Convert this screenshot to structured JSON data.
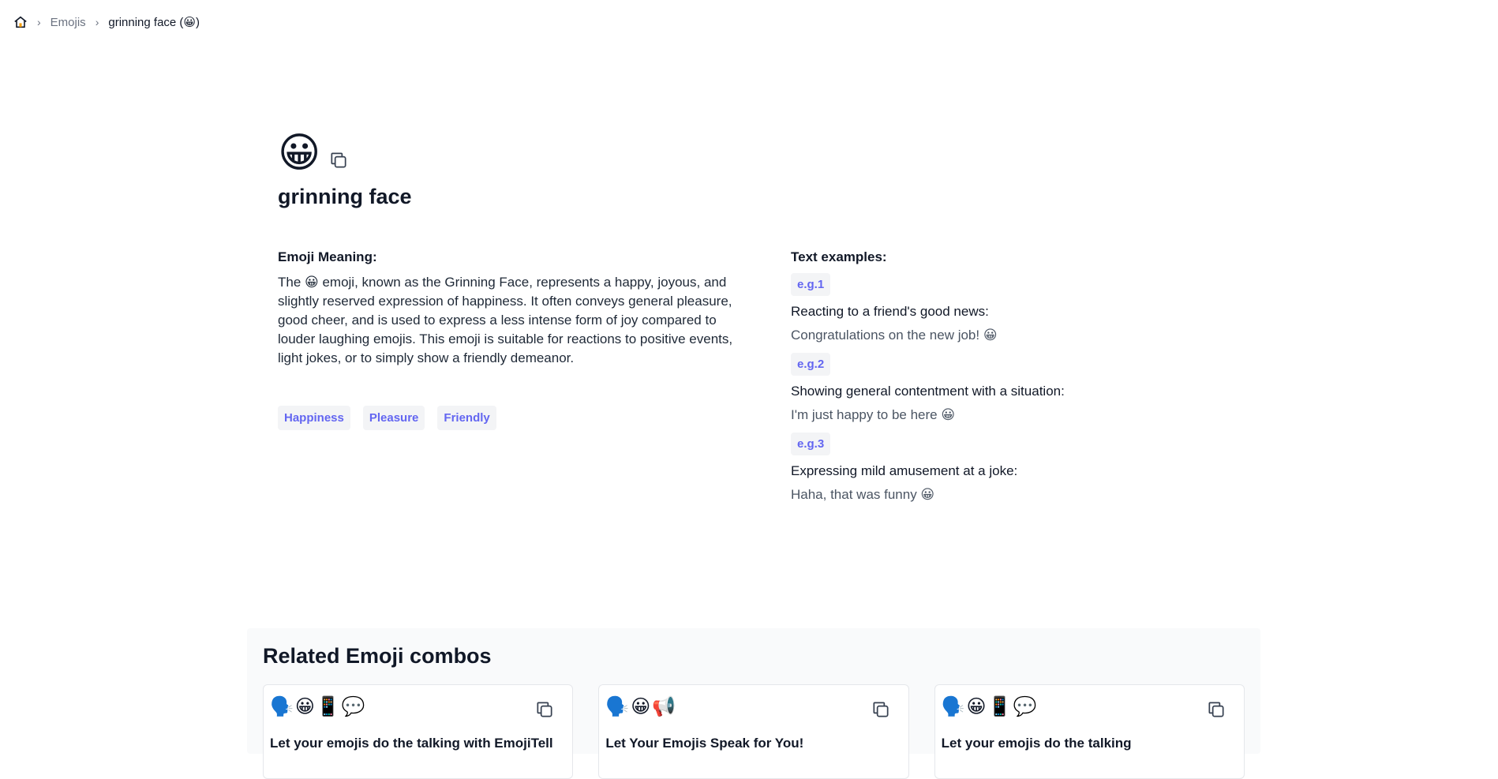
{
  "breadcrumb": {
    "home_icon": "home-icon",
    "items": [
      "Emojis",
      "grinning face (😀)"
    ]
  },
  "emoji": {
    "glyph": "😀",
    "name": "grinning face"
  },
  "meaning": {
    "label": "Emoji Meaning:",
    "text": "The 😀 emoji, known as the Grinning Face, represents a happy, joyous, and slightly reserved expression of happiness. It often conveys general pleasure, good cheer, and is used to express a less intense form of joy compared to louder laughing emojis. This emoji is suitable for reactions to positive events, light jokes, or to simply show a friendly demeanor.",
    "tags": [
      "Happiness",
      "Pleasure",
      "Friendly"
    ]
  },
  "examples": {
    "label": "Text examples:",
    "items": [
      {
        "badge": "e.g.1",
        "context": "Reacting to a friend's good news:",
        "text": "Congratulations on the new job! 😀"
      },
      {
        "badge": "e.g.2",
        "context": "Showing general contentment with a situation:",
        "text": "I'm just happy to be here 😀"
      },
      {
        "badge": "e.g.3",
        "context": "Expressing mild amusement at a joke:",
        "text": "Haha, that was funny 😀"
      }
    ]
  },
  "related": {
    "title": "Related Emoji combos",
    "cards": [
      {
        "emojis": "🗣️😀📱💬",
        "title": "Let your emojis do the talking with EmojiTell"
      },
      {
        "emojis": "🗣️😀📢",
        "title": "Let Your Emojis Speak for You!"
      },
      {
        "emojis": "🗣️😀📱💬",
        "title": "Let your emojis do the talking"
      }
    ]
  },
  "colors": {
    "accent": "#6366f1",
    "tag_bg": "#f3f4f6"
  }
}
